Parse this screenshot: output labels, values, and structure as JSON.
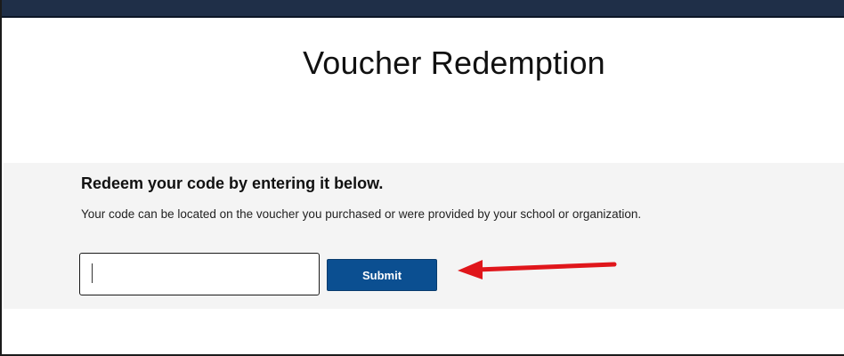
{
  "page": {
    "title": "Voucher Redemption"
  },
  "redeem": {
    "heading": "Redeem your code by entering it below.",
    "description": "Your code can be located on the voucher you purchased or were provided by your school or organization.",
    "code_input": {
      "value": "",
      "placeholder": ""
    },
    "submit_label": "Submit"
  },
  "annotation": {
    "arrow_color": "#e0161b",
    "arrow_direction": "left"
  },
  "colors": {
    "top_bar": "#1f2f48",
    "panel_background": "#f4f4f4",
    "submit_button": "#0b4f91"
  }
}
